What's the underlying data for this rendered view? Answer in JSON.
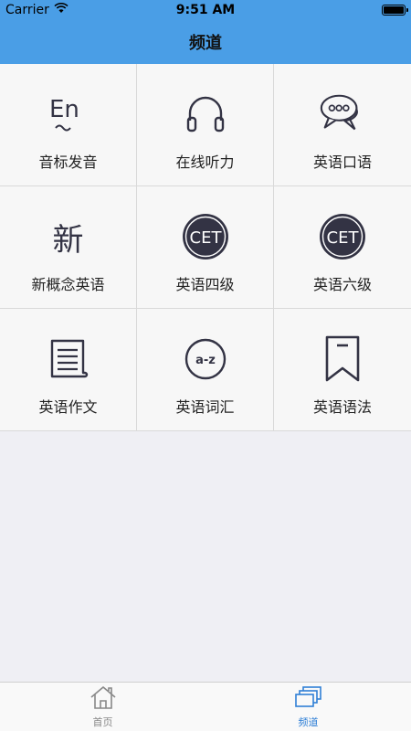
{
  "status_bar": {
    "carrier": "Carrier",
    "time": "9:51 AM"
  },
  "nav": {
    "title": "频道"
  },
  "channels": [
    {
      "label": "音标发音",
      "icon": "en-phonetic-icon"
    },
    {
      "label": "在线听力",
      "icon": "headphones-icon"
    },
    {
      "label": "英语口语",
      "icon": "chat-bubbles-icon"
    },
    {
      "label": "新概念英语",
      "icon": "xin-character-icon",
      "glyph": "新"
    },
    {
      "label": "英语四级",
      "icon": "cet-badge-icon",
      "badge": "CET"
    },
    {
      "label": "英语六级",
      "icon": "cet-badge-icon",
      "badge": "CET"
    },
    {
      "label": "英语作文",
      "icon": "document-icon"
    },
    {
      "label": "英语词汇",
      "icon": "a-z-icon",
      "badge": "a-z"
    },
    {
      "label": "英语语法",
      "icon": "bookmark-icon"
    }
  ],
  "tabs": [
    {
      "label": "首页",
      "icon": "home-icon",
      "active": false
    },
    {
      "label": "频道",
      "icon": "channels-icon",
      "active": true
    }
  ],
  "colors": {
    "nav": "#4a9ee6",
    "icon": "#333344",
    "tab_active": "#2f7fd6",
    "tab_inactive": "#888888"
  }
}
